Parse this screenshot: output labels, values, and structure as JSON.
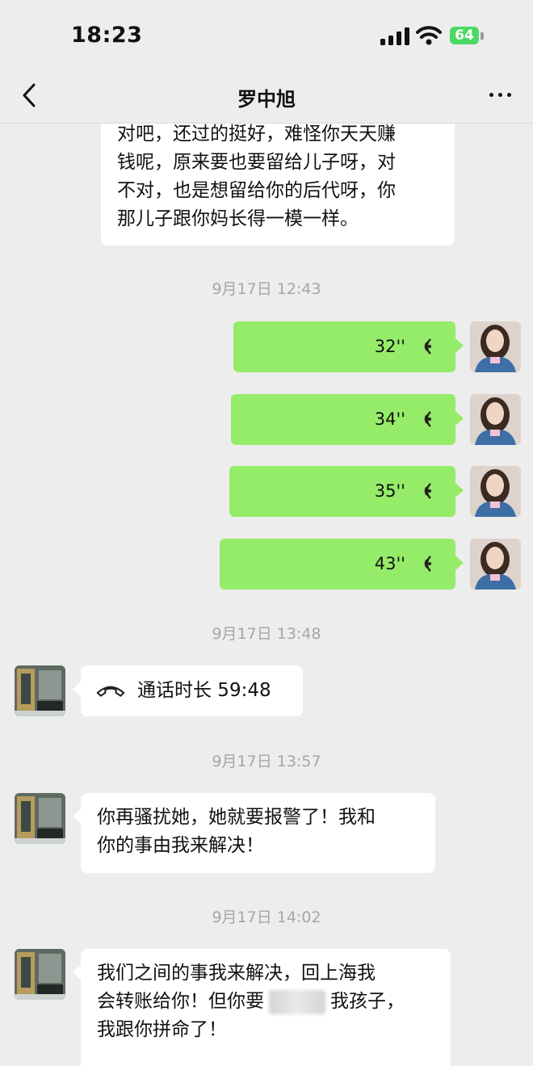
{
  "status_bar": {
    "time": "18:23",
    "battery": "64"
  },
  "header": {
    "title": "罗中旭"
  },
  "messages": {
    "m1": {
      "line1": "对吧，还过的挺好，难怪你天天赚",
      "line2": "钱呢，原来要也要留给儿子呀，对",
      "line3": "不对，也是想留给你的后代呀，你",
      "line4": "那儿子跟你妈长得一模一样。"
    },
    "ts1": "9月17日 12:43",
    "voices": [
      {
        "duration": "32''"
      },
      {
        "duration": "34''"
      },
      {
        "duration": "35''"
      },
      {
        "duration": "43''"
      }
    ],
    "ts2": "9月17日 13:48",
    "call": {
      "text": "通话时长 59:48"
    },
    "ts3": "9月17日 13:57",
    "m2": {
      "line1": "你再骚扰她，她就要报警了！我和",
      "line2": "你的事由我来解决！"
    },
    "ts4": "9月17日 14:02",
    "m3": {
      "line1": "我们之间的事我来解决，回上海我",
      "line2a": "会转账给你！但你要",
      "line2b": "我孩子，",
      "line3": "我跟你拼命了！"
    }
  },
  "icons": {
    "back": "chevron-left-icon",
    "more": "more-dots-icon",
    "voice": "voice-wave-icon",
    "phone": "phone-icon",
    "signal": "cellular-signal-icon",
    "wifi": "wifi-icon",
    "battery": "battery-icon"
  },
  "colors": {
    "background": "#ededed",
    "outgoing_bubble": "#95ec69",
    "incoming_bubble": "#ffffff",
    "battery": "#4cd964",
    "timestamp": "#a6a6a6"
  }
}
